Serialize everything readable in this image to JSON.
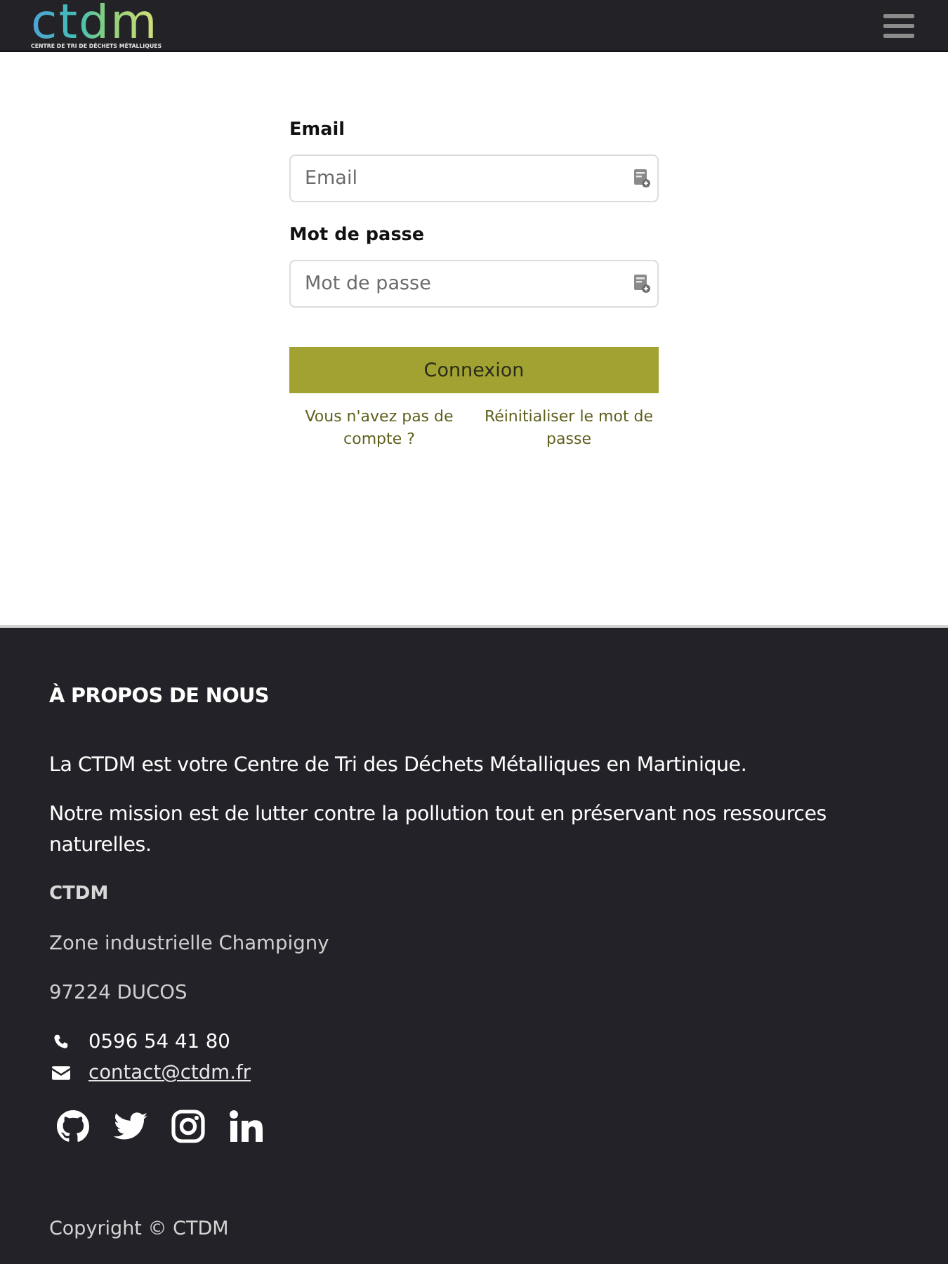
{
  "header": {
    "logo": {
      "wordmark": "ctdm",
      "tagline": "CENTRE DE TRI DE DÉCHETS MÉTALLIQUES"
    }
  },
  "login_form": {
    "fields": [
      {
        "label": "Email",
        "placeholder": "Email"
      },
      {
        "label": "Mot de passe",
        "placeholder": "Mot de passe"
      }
    ],
    "submit": "Connexion",
    "links": [
      "Vous n'avez pas de compte ?",
      "Réinitialiser le mot de passe"
    ]
  },
  "footer": {
    "heading": "À PROPOS DE NOUS",
    "paragraphs": [
      "La CTDM est votre Centre de Tri des Déchets Métalliques en Martinique.",
      "Notre mission est de lutter contre la pollution tout en préservant nos ressources naturelles."
    ],
    "company": "CTDM",
    "address": [
      "Zone industrielle Champigny",
      "97224 DUCOS"
    ],
    "contacts": [
      {
        "kind": "phone",
        "text": "0596 54 41 80"
      },
      {
        "kind": "email",
        "text": "contact@ctdm.fr"
      }
    ],
    "social": [
      {
        "kind": "github"
      },
      {
        "kind": "twitter"
      },
      {
        "kind": "instagram"
      },
      {
        "kind": "linkedin"
      }
    ],
    "copyright": "Copyright © CTDM"
  }
}
